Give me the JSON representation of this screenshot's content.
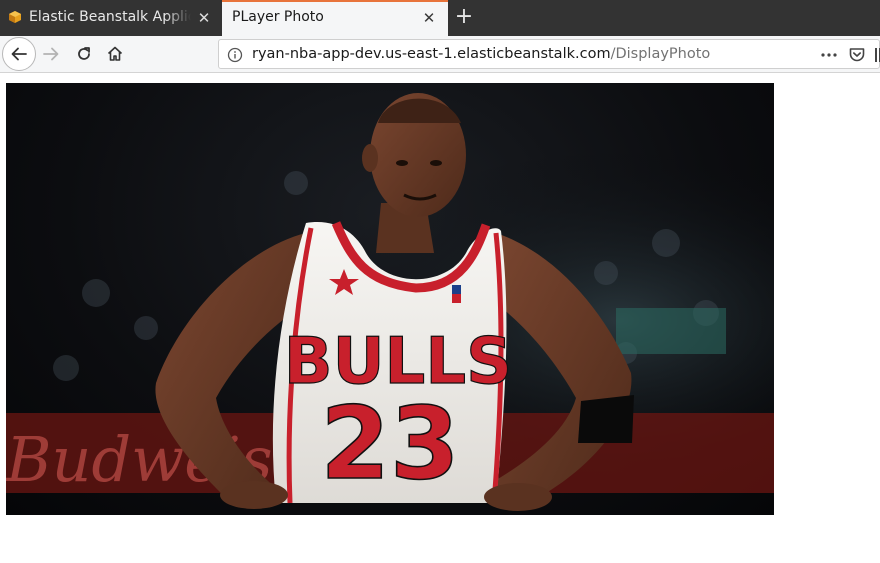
{
  "browser": {
    "tabs": [
      {
        "title": "Elastic Beanstalk Application",
        "favicon": "aws-box-icon",
        "active": false
      },
      {
        "title": "PLayer Photo",
        "active": true
      }
    ],
    "new_tab_icon": "plus-icon",
    "url": {
      "host": "ryan-nba-app-dev.us-east-1.elasticbeanstalk.com",
      "path": "/DisplayPhoto"
    },
    "toolbar_icons": [
      "back-arrow-icon",
      "forward-arrow-icon",
      "reload-icon",
      "home-icon",
      "info-icon",
      "more-dots-icon",
      "pocket-icon",
      "library-icon"
    ]
  },
  "photo": {
    "subject": "basketball player",
    "jersey_team": "BULLS",
    "jersey_number": "23",
    "background_text": "Budweiser",
    "colors": {
      "jersey": "#f3f1ee",
      "jersey_trim": "#c8202c",
      "background": "#0c0d10",
      "skin": "#6b3d26"
    }
  }
}
